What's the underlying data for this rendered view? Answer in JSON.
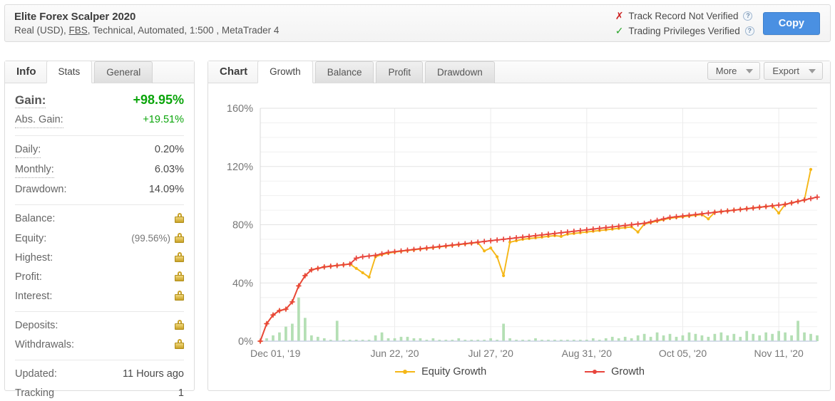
{
  "header": {
    "account_title": "Elite Forex Scalper 2020",
    "subtitle_prefix": "Real (USD), ",
    "broker": "FBS",
    "subtitle_suffix": ", Technical, Automated, 1:500 , MetaTrader 4",
    "verification": [
      {
        "icon": "cross-icon",
        "status": "not-verified",
        "label": "Track Record Not Verified",
        "help": "?"
      },
      {
        "icon": "check-icon",
        "status": "verified",
        "label": "Trading Privileges Verified",
        "help": "?"
      }
    ],
    "copy_label": "Copy",
    "colors": {
      "copy_button": "#4a90e2",
      "not_verified": "#cc2222",
      "verified": "#27a327"
    }
  },
  "sidebar": {
    "title": "Info",
    "tabs": [
      {
        "label": "Stats",
        "active": true
      },
      {
        "label": "General",
        "active": false
      }
    ],
    "groups": [
      {
        "rows": [
          {
            "label": "Gain:",
            "value": "+98.95%",
            "emphasis": "big",
            "tone": "green",
            "lock": false
          },
          {
            "label": "Abs. Gain:",
            "value": "+19.51%",
            "tone": "green",
            "lock": false
          }
        ]
      },
      {
        "rows": [
          {
            "label": "Daily:",
            "value": "0.20%",
            "lock": false
          },
          {
            "label": "Monthly:",
            "value": "6.03%",
            "lock": false
          },
          {
            "label": "Drawdown:",
            "value": "14.09%",
            "lock": false
          }
        ]
      },
      {
        "rows": [
          {
            "label": "Balance:",
            "value": "",
            "lock": true
          },
          {
            "label": "Equity:",
            "value": "",
            "paren": "(99.56%)",
            "lock": true
          },
          {
            "label": "Highest:",
            "value": "",
            "lock": true
          },
          {
            "label": "Profit:",
            "value": "",
            "lock": true
          },
          {
            "label": "Interest:",
            "value": "",
            "lock": true
          }
        ]
      },
      {
        "rows": [
          {
            "label": "Deposits:",
            "value": "",
            "lock": true
          },
          {
            "label": "Withdrawals:",
            "value": "",
            "lock": true
          }
        ]
      },
      {
        "rows": [
          {
            "label": "Updated:",
            "value": "11 Hours ago",
            "plain": true,
            "lock": false
          },
          {
            "label": "Tracking",
            "value": "1",
            "plain": true,
            "lock": false
          }
        ]
      }
    ]
  },
  "chart_panel": {
    "title": "Chart",
    "tabs": [
      {
        "label": "Growth",
        "active": true
      },
      {
        "label": "Balance",
        "active": false
      },
      {
        "label": "Profit",
        "active": false
      },
      {
        "label": "Drawdown",
        "active": false
      }
    ],
    "actions": [
      {
        "label": "More",
        "icon": "chevron-down-icon"
      },
      {
        "label": "Export",
        "icon": "chevron-down-icon"
      }
    ]
  },
  "chart_data": {
    "type": "line",
    "title": "",
    "xlabel": "",
    "ylabel": "",
    "ylim": [
      0,
      160
    ],
    "yticks": [
      0,
      40,
      80,
      120,
      160
    ],
    "ytick_labels": [
      "0%",
      "40%",
      "80%",
      "120%",
      "160%"
    ],
    "minor_gridline_step": 10,
    "grid": true,
    "legend_position": "bottom",
    "xtick_labels": [
      "Dec 01, '19",
      "Jun 22, '20",
      "Jul 27, '20",
      "Aug 31, '20",
      "Oct 05, '20",
      "Nov 11, '20"
    ],
    "xtick_positions": [
      0,
      21,
      36,
      51,
      66,
      81
    ],
    "x_count": 88,
    "series": [
      {
        "name": "Growth",
        "color": "#e8453c",
        "marker": "plus",
        "values": [
          0,
          12,
          18,
          21,
          22,
          27,
          38,
          45,
          49,
          50,
          51,
          51.5,
          52,
          52.5,
          53,
          57,
          58,
          58.5,
          59,
          60,
          61,
          61.5,
          62,
          62.5,
          63,
          63.5,
          64,
          64.5,
          65,
          65.5,
          66,
          66.5,
          67,
          67.5,
          68,
          68.5,
          69,
          69.5,
          70,
          70.5,
          71,
          71.5,
          72,
          72.5,
          73,
          73.5,
          74,
          74.5,
          75,
          75.5,
          76,
          76.5,
          77,
          77.5,
          78,
          78.5,
          79,
          79.5,
          80,
          80.5,
          81,
          82,
          83,
          84,
          85,
          85.5,
          86,
          86.5,
          87,
          87.5,
          88,
          88.5,
          89,
          89.5,
          90,
          90.5,
          91,
          91.5,
          92,
          92.5,
          93,
          93.5,
          94,
          95,
          96,
          97,
          98,
          98.95
        ]
      },
      {
        "name": "Equity Growth",
        "color": "#f5b717",
        "marker": "circle",
        "values": [
          0,
          12,
          18,
          21,
          22,
          27,
          38,
          45,
          49,
          50,
          51,
          51.5,
          52,
          52.5,
          53,
          50,
          47,
          44,
          58,
          59.5,
          60.5,
          61.2,
          61.8,
          62.3,
          62.8,
          63.3,
          63.8,
          64.3,
          64.8,
          65.3,
          65.8,
          66.3,
          66.8,
          67.3,
          67.8,
          62,
          64,
          58,
          45,
          68,
          69,
          70,
          70.5,
          71,
          71.5,
          72,
          72.5,
          72,
          73.5,
          74,
          74.5,
          75,
          75.5,
          76,
          76.5,
          77,
          77.5,
          78,
          78.5,
          75,
          80.5,
          81.5,
          82.5,
          83.5,
          84.5,
          85,
          85.5,
          86,
          86.5,
          87,
          84,
          88.5,
          89,
          89.5,
          90,
          90.5,
          91,
          91.5,
          92,
          92.5,
          93,
          88,
          94,
          95,
          96,
          97,
          118
        ]
      }
    ],
    "volume": {
      "name": "Volume",
      "color": "#b4dfb4",
      "axis_max": 160,
      "values": [
        0,
        2,
        4,
        6,
        10,
        12,
        30,
        16,
        4,
        3,
        2,
        1,
        14,
        1,
        1,
        1,
        1,
        1,
        4,
        6,
        2,
        2,
        3,
        3,
        2,
        2,
        1,
        2,
        1,
        1,
        1,
        2,
        1,
        1,
        1,
        1,
        2,
        1,
        12,
        2,
        1,
        1,
        1,
        2,
        1,
        1,
        1,
        1,
        1,
        1,
        1,
        1,
        2,
        1,
        2,
        3,
        2,
        3,
        2,
        4,
        5,
        3,
        6,
        4,
        5,
        3,
        4,
        6,
        5,
        4,
        3,
        5,
        6,
        4,
        5,
        3,
        7,
        5,
        4,
        6,
        5,
        7,
        6,
        4,
        14,
        6,
        5,
        4
      ]
    }
  },
  "legend": [
    {
      "label": "Equity Growth",
      "color": "#f5b717"
    },
    {
      "label": "Growth",
      "color": "#e8453c"
    }
  ]
}
